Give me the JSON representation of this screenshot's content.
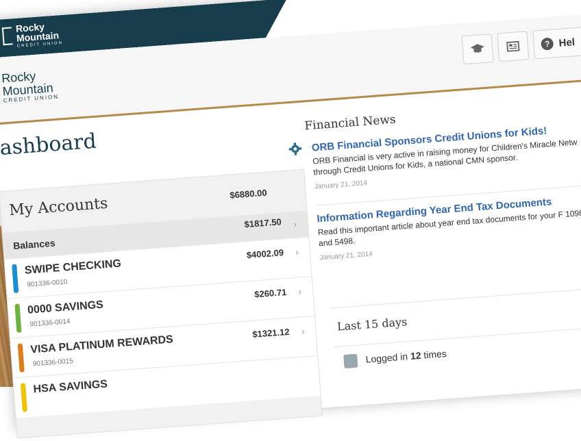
{
  "brand": {
    "small_logo": [
      "Rocky",
      "Mountain",
      "CREDIT UNION"
    ],
    "main_logo": [
      "Rocky",
      "Mountain",
      "CREDIT UNION"
    ]
  },
  "header": {
    "help_label": "Hel"
  },
  "page": {
    "title": "ashboard"
  },
  "accounts": {
    "title": "My Accounts",
    "total": "$6880.00",
    "balances_label": "Balances",
    "balances_amount": "$1817.50",
    "items": [
      {
        "name": "SWIPE CHECKING",
        "number": "901336-0010",
        "amount": "$4002.09",
        "color": "#1a8fd6"
      },
      {
        "name": "0000 SAVINGS",
        "number": "901336-0014",
        "amount": "$260.71",
        "color": "#6bb33a"
      },
      {
        "name": "VISA PLATINUM REWARDS",
        "number": "901336-0015",
        "amount": "$1321.12",
        "color": "#e07b1a"
      },
      {
        "name": "HSA SAVINGS",
        "number": "",
        "amount": "",
        "color": "#f2c200"
      }
    ]
  },
  "news": {
    "title": "Financial News",
    "items": [
      {
        "headline": "ORB Financial Sponsors Credit Unions for Kids!",
        "body": "ORB Financial is very active in raising money for Children's Miracle Netw through Credit Unions for Kids, a national CMN sponsor.",
        "date": "January 21, 2014"
      },
      {
        "headline": "Information Regarding Year End Tax Documents",
        "body": "Read this important article about year end tax documents for your F 1098 and 5498.",
        "date": "January 21, 2014"
      }
    ]
  },
  "recent": {
    "title": "Last 15 days",
    "login_prefix": "Logged in",
    "login_count": "12",
    "login_suffix": "times"
  },
  "colors": {
    "brand_dark": "#173d4d",
    "accent_gold": "#b48a4b",
    "link_blue": "#2f65b3"
  }
}
